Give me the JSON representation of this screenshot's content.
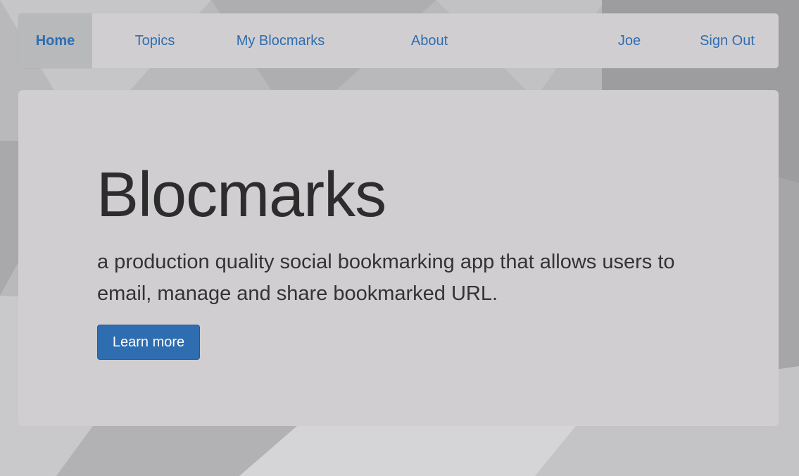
{
  "nav": {
    "home": "Home",
    "topics": "Topics",
    "my_blocmarks": "My Blocmarks",
    "about": "About",
    "user": "Joe",
    "sign_out": "Sign Out"
  },
  "hero": {
    "title": "Blocmarks",
    "description": "a production quality social bookmarking app that allows users to email, manage and share bookmarked URL.",
    "button_label": "Learn more"
  },
  "colors": {
    "link": "#2f6db1",
    "panel": "#d0ced1",
    "active_nav": "#b7b9bb",
    "button": "#2f6db1",
    "heading": "#2d2d2d"
  }
}
